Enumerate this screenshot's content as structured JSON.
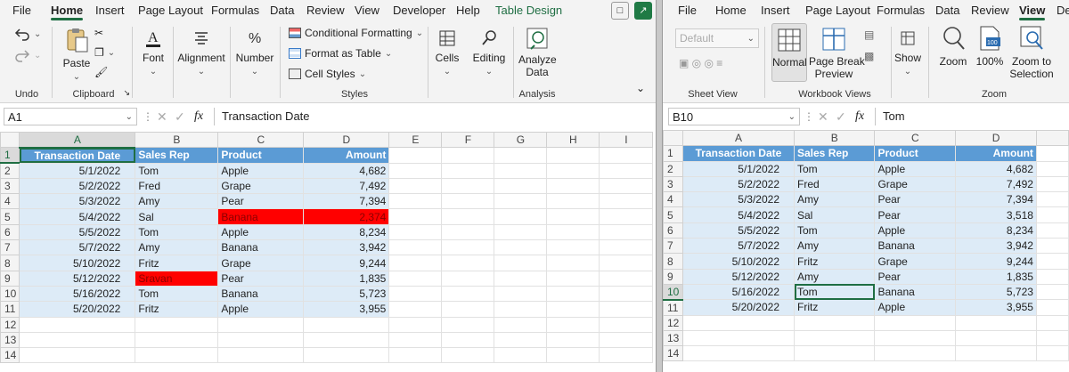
{
  "left": {
    "menu": [
      "File",
      "Home",
      "Insert",
      "Page Layout",
      "Formulas",
      "Data",
      "Review",
      "View",
      "Developer",
      "Help",
      "Table Design"
    ],
    "ribbon": {
      "undo_group": "Undo",
      "clipboard_group": "Clipboard",
      "paste": "Paste",
      "font": "Font",
      "alignment": "Alignment",
      "number": "Number",
      "conditional_formatting": "Conditional Formatting",
      "format_as_table": "Format as Table",
      "cell_styles": "Cell Styles",
      "styles_group": "Styles",
      "cells": "Cells",
      "editing": "Editing",
      "analyze_data_1": "Analyze",
      "analyze_data_2": "Data",
      "analysis_group": "Analysis"
    },
    "formula_bar": {
      "name_box": "A1",
      "fx": "fx",
      "value": "Transaction Date"
    },
    "columns": [
      "A",
      "B",
      "C",
      "D",
      "E",
      "F",
      "G",
      "H",
      "I"
    ],
    "header_row": [
      "Transaction Date",
      "Sales Rep",
      "Product",
      "Amount"
    ],
    "rows": [
      [
        "5/1/2022",
        "Tom",
        "Apple",
        "4,682"
      ],
      [
        "5/2/2022",
        "Fred",
        "Grape",
        "7,492"
      ],
      [
        "5/3/2022",
        "Amy",
        "Pear",
        "7,394"
      ],
      [
        "5/4/2022",
        "Sal",
        "Banana",
        "2,374"
      ],
      [
        "5/5/2022",
        "Tom",
        "Apple",
        "8,234"
      ],
      [
        "5/7/2022",
        "Amy",
        "Banana",
        "3,942"
      ],
      [
        "5/10/2022",
        "Fritz",
        "Grape",
        "9,244"
      ],
      [
        "5/12/2022",
        "Sravan",
        "Pear",
        "1,835"
      ],
      [
        "5/16/2022",
        "Tom",
        "Banana",
        "5,723"
      ],
      [
        "5/20/2022",
        "Fritz",
        "Apple",
        "3,955"
      ]
    ],
    "row_numbers": [
      "1",
      "2",
      "3",
      "4",
      "5",
      "6",
      "7",
      "8",
      "9",
      "10",
      "11",
      "12",
      "13",
      "14"
    ],
    "highlight_color": "#ff0000"
  },
  "right": {
    "menu": [
      "File",
      "Home",
      "Insert",
      "Page Layout",
      "Formulas",
      "Data",
      "Review",
      "View",
      "De"
    ],
    "ribbon": {
      "sheet_view_default": "Default",
      "sheet_view_group": "Sheet View",
      "normal": "Normal",
      "page_break_1": "Page Break",
      "page_break_2": "Preview",
      "workbook_views_group": "Workbook Views",
      "show": "Show",
      "zoom": "Zoom",
      "zoom100": "100%",
      "zoom_sel_1": "Zoom to",
      "zoom_sel_2": "Selection",
      "zoom_group": "Zoom",
      "zoom_badge": "100"
    },
    "formula_bar": {
      "name_box": "B10",
      "fx": "fx",
      "value": "Tom"
    },
    "columns": [
      "A",
      "B",
      "C",
      "D"
    ],
    "header_row": [
      "Transaction Date",
      "Sales Rep",
      "Product",
      "Amount"
    ],
    "rows": [
      [
        "5/1/2022",
        "Tom",
        "Apple",
        "4,682"
      ],
      [
        "5/2/2022",
        "Fred",
        "Grape",
        "7,492"
      ],
      [
        "5/3/2022",
        "Amy",
        "Pear",
        "7,394"
      ],
      [
        "5/4/2022",
        "Sal",
        "Pear",
        "3,518"
      ],
      [
        "5/5/2022",
        "Tom",
        "Apple",
        "8,234"
      ],
      [
        "5/7/2022",
        "Amy",
        "Banana",
        "3,942"
      ],
      [
        "5/10/2022",
        "Fritz",
        "Grape",
        "9,244"
      ],
      [
        "5/12/2022",
        "Amy",
        "Pear",
        "1,835"
      ],
      [
        "5/16/2022",
        "Tom",
        "Banana",
        "5,723"
      ],
      [
        "5/20/2022",
        "Fritz",
        "Apple",
        "3,955"
      ]
    ],
    "row_numbers": [
      "1",
      "2",
      "3",
      "4",
      "5",
      "6",
      "7",
      "8",
      "9",
      "10",
      "11",
      "12",
      "13",
      "14"
    ]
  },
  "colors": {
    "accent_green": "#1f6e43",
    "table_header_blue": "#5b9bd5",
    "table_band_blue": "#ddebf7"
  }
}
